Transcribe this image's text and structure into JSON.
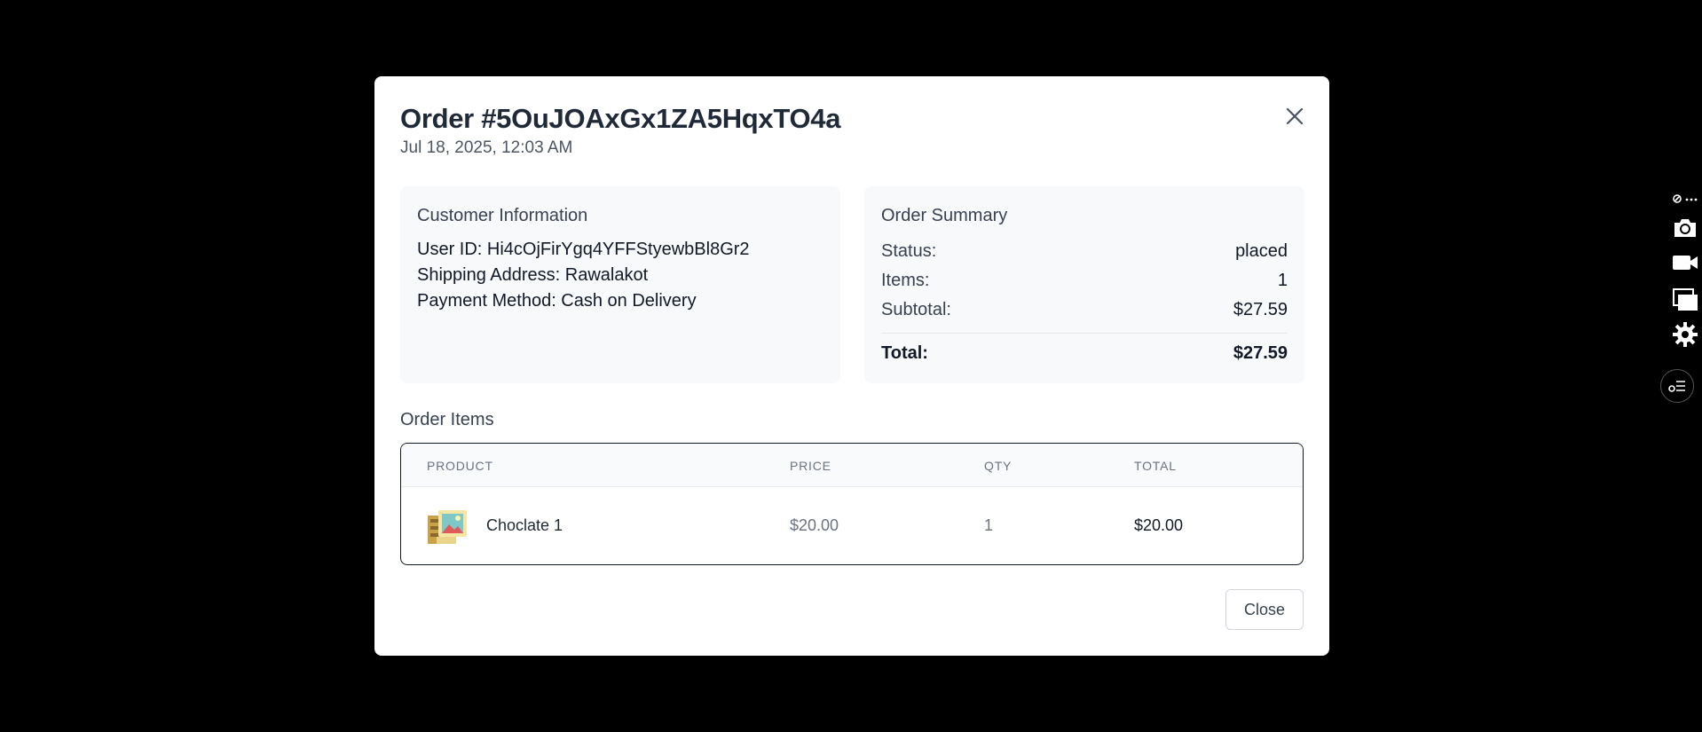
{
  "modal": {
    "title": "Order #5OuJOAxGx1ZA5HqxTO4a",
    "date": "Jul 18, 2025, 12:03 AM",
    "close_icon": "close-icon",
    "close_button_label": "Close"
  },
  "customer": {
    "title": "Customer Information",
    "user_id": "User ID: Hi4cOjFirYgq4YFFStyewbBl8Gr2",
    "shipping": "Shipping Address: Rawalakot",
    "payment": "Payment Method: Cash on Delivery"
  },
  "summary": {
    "title": "Order Summary",
    "status_label": "Status:",
    "status_value": "placed",
    "items_label": "Items:",
    "items_value": "1",
    "subtotal_label": "Subtotal:",
    "subtotal_value": "$27.59",
    "total_label": "Total:",
    "total_value": "$27.59"
  },
  "items": {
    "heading": "Order Items",
    "columns": [
      "PRODUCT",
      "PRICE",
      "QTY",
      "TOTAL"
    ],
    "rows": [
      {
        "product": "Choclate 1",
        "price": "$20.00",
        "qty": "1",
        "total": "$20.00",
        "thumb_icon": "product-image-placeholder-icon"
      }
    ]
  },
  "toolbar": {
    "icons": [
      "extension-menu-icon",
      "camera-icon",
      "video-camera-icon",
      "windows-icon",
      "gear-icon"
    ],
    "assistant_icon": "assistant-list-icon"
  }
}
